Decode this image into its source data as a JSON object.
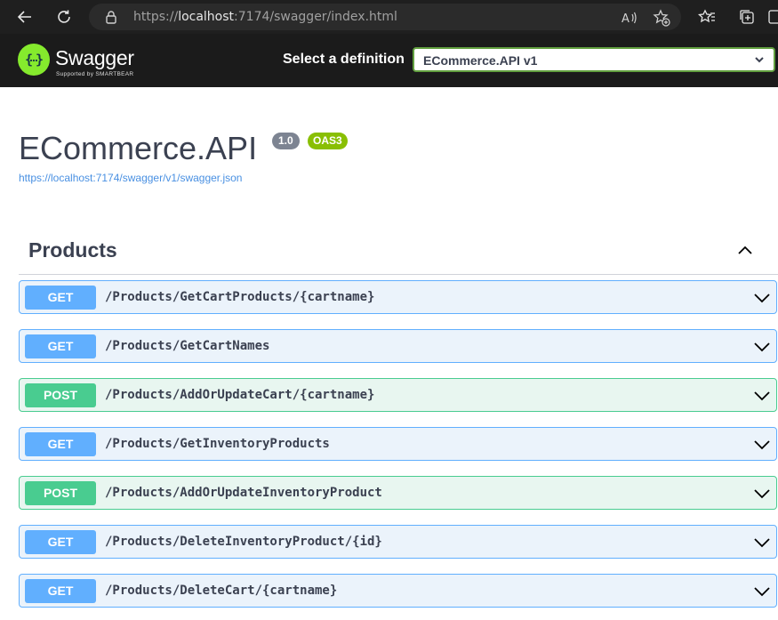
{
  "browser": {
    "url_prefix": "https://",
    "url_host": "localhost",
    "url_rest": ":7174/swagger/index.html"
  },
  "swagger": {
    "logo_text": "Swagger",
    "logo_subtext": "Supported by SMARTBEAR",
    "select_label": "Select a definition",
    "selected_definition": "ECommerce.API v1"
  },
  "info": {
    "title": "ECommerce.API",
    "version": "1.0",
    "oas": "OAS3",
    "spec_url": "https://localhost:7174/swagger/v1/swagger.json"
  },
  "section": {
    "tag": "Products"
  },
  "operations": [
    {
      "method": "GET",
      "path": "/Products/GetCartProducts/{cartname}"
    },
    {
      "method": "GET",
      "path": "/Products/GetCartNames"
    },
    {
      "method": "POST",
      "path": "/Products/AddOrUpdateCart/{cartname}"
    },
    {
      "method": "GET",
      "path": "/Products/GetInventoryProducts"
    },
    {
      "method": "POST",
      "path": "/Products/AddOrUpdateInventoryProduct"
    },
    {
      "method": "GET",
      "path": "/Products/DeleteInventoryProduct/{id}"
    },
    {
      "method": "GET",
      "path": "/Products/DeleteCart/{cartname}"
    }
  ],
  "colors": {
    "get": "#61affe",
    "post": "#49cc90",
    "swagger_green": "#85ea2d"
  }
}
